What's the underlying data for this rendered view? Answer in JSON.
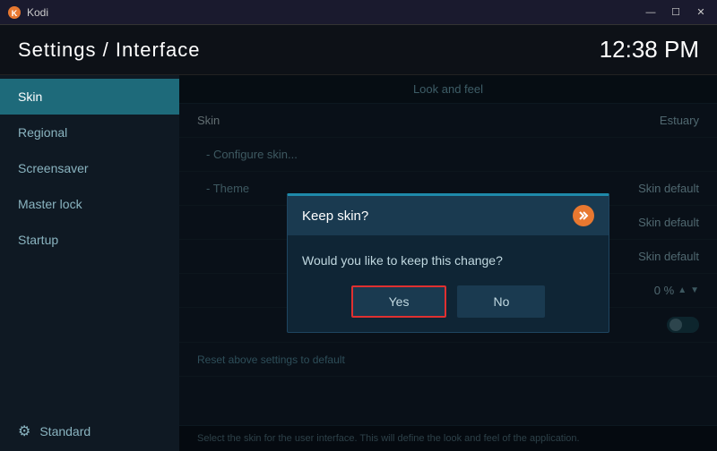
{
  "titlebar": {
    "title": "Kodi",
    "controls": {
      "minimize": "—",
      "maximize": "☐",
      "close": "✕"
    }
  },
  "header": {
    "title": "Settings / Interface",
    "time": "12:38 PM"
  },
  "sidebar": {
    "items": [
      {
        "id": "skin",
        "label": "Skin",
        "active": true
      },
      {
        "id": "regional",
        "label": "Regional",
        "active": false
      },
      {
        "id": "screensaver",
        "label": "Screensaver",
        "active": false
      },
      {
        "id": "master-lock",
        "label": "Master lock",
        "active": false
      },
      {
        "id": "startup",
        "label": "Startup",
        "active": false
      }
    ],
    "bottom_item": {
      "label": "Standard",
      "icon": "⚙"
    }
  },
  "section_header": "Look and feel",
  "settings_rows": [
    {
      "label": "Skin",
      "value": "Estuary",
      "type": "value"
    },
    {
      "label": "- Configure skin...",
      "value": "",
      "type": "link"
    },
    {
      "label": "- Theme",
      "value": "Skin default",
      "type": "value"
    },
    {
      "label": "",
      "value": "Skin default",
      "type": "value"
    },
    {
      "label": "",
      "value": "Skin default",
      "type": "value"
    },
    {
      "label": "",
      "value": "0 %",
      "type": "percent"
    },
    {
      "label": "",
      "value": "",
      "type": "toggle"
    }
  ],
  "reset_label": "Reset above settings to default",
  "bottom_bar_text": "Select the skin for the user interface. This will define the look and feel of the application.",
  "dialog": {
    "title": "Keep skin?",
    "message": "Would you like to keep this change?",
    "yes_label": "Yes",
    "no_label": "No"
  }
}
